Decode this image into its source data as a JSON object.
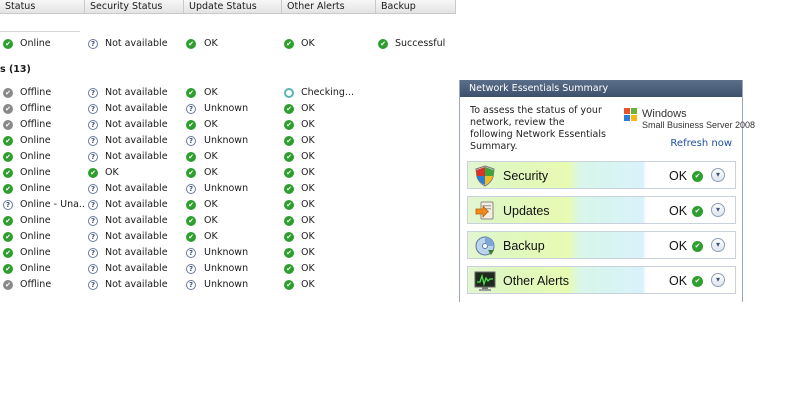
{
  "columns": [
    "Status",
    "Security Status",
    "Update Status",
    "Other Alerts",
    "Backup"
  ],
  "server_row": {
    "status": "Online",
    "security": "Not available",
    "update": "OK",
    "alerts": "OK",
    "backup": "Successful"
  },
  "group_label": "s (13)",
  "client_rows": [
    {
      "status": "Offline",
      "security": "Not available",
      "update": "OK",
      "alerts": "Checking..."
    },
    {
      "status": "Offline",
      "security": "Not available",
      "update": "Unknown",
      "alerts": "OK"
    },
    {
      "status": "Offline",
      "security": "Not available",
      "update": "OK",
      "alerts": "OK"
    },
    {
      "status": "Online",
      "security": "Not available",
      "update": "Unknown",
      "alerts": "OK"
    },
    {
      "status": "Online",
      "security": "Not available",
      "update": "OK",
      "alerts": "OK"
    },
    {
      "status": "Online",
      "security": "OK",
      "update": "OK",
      "alerts": "OK"
    },
    {
      "status": "Online",
      "security": "Not available",
      "update": "Unknown",
      "alerts": "OK"
    },
    {
      "status": "Online - Una...",
      "security": "Not available",
      "update": "OK",
      "alerts": "OK"
    },
    {
      "status": "Online",
      "security": "Not available",
      "update": "OK",
      "alerts": "OK"
    },
    {
      "status": "Online",
      "security": "Not available",
      "update": "OK",
      "alerts": "OK"
    },
    {
      "status": "Online",
      "security": "Not available",
      "update": "Unknown",
      "alerts": "OK"
    },
    {
      "status": "Online",
      "security": "Not available",
      "update": "Unknown",
      "alerts": "OK"
    },
    {
      "status": "Offline",
      "security": "Not available",
      "update": "Unknown",
      "alerts": "OK"
    }
  ],
  "summary": {
    "title": "Network Essentials Summary",
    "intro": "To assess the status of your network, review the following Network Essentials Summary.",
    "logo_line1": "Windows",
    "logo_line2": "Small Business Server 2008",
    "refresh_label": "Refresh now",
    "items": [
      {
        "label": "Security",
        "value": "OK",
        "icon": "shield-icon"
      },
      {
        "label": "Updates",
        "value": "OK",
        "icon": "updates-icon"
      },
      {
        "label": "Backup",
        "value": "OK",
        "icon": "backup-disk-icon"
      },
      {
        "label": "Other Alerts",
        "value": "OK",
        "icon": "monitor-alert-icon"
      }
    ]
  },
  "colors": {
    "ok_green": "#2e9e2e",
    "offline_gray": "#8a8a8a",
    "link_blue": "#1d4f9c",
    "panel_header": "#3d506b"
  }
}
